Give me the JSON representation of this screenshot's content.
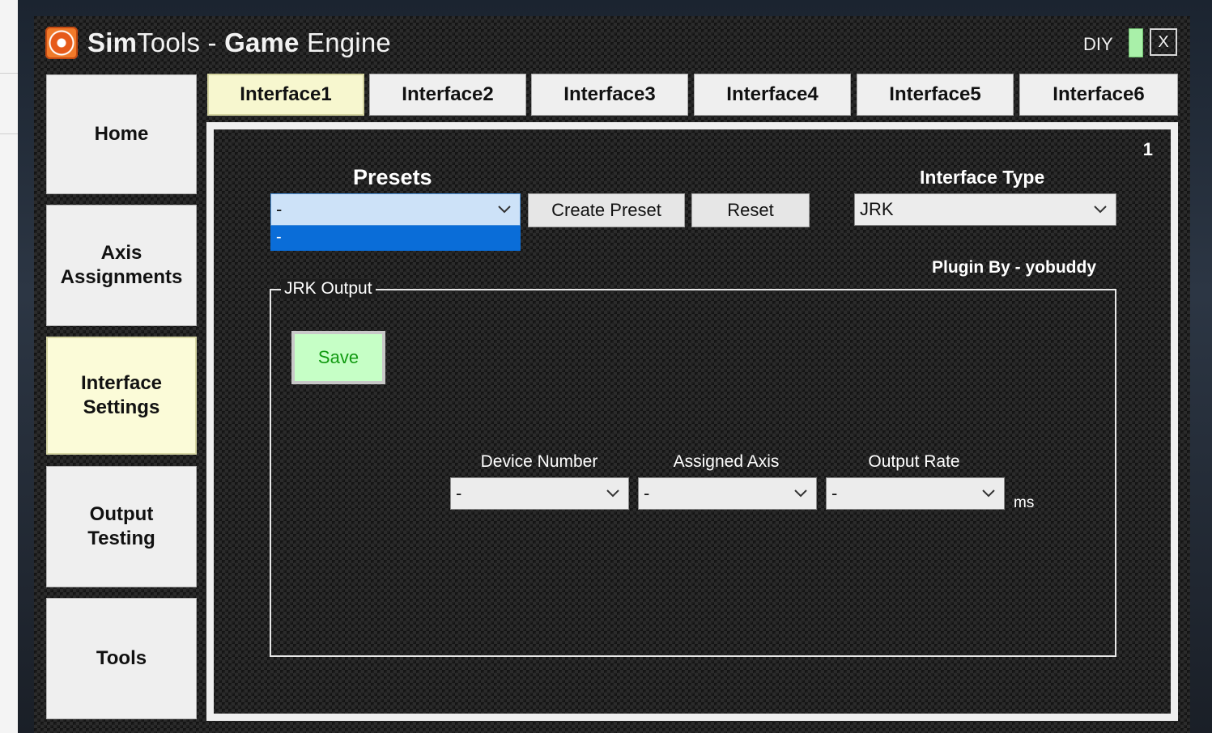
{
  "window": {
    "title_bold_1": "Sim",
    "title_plain_1": "Tools - ",
    "title_bold_2": "Game",
    "title_plain_2": " Engine",
    "diy_label": "DIY",
    "close_label": "X",
    "diy_indicator_color": "#a9f0a9"
  },
  "sidebar": {
    "items": [
      {
        "label_line1": "Home",
        "label_line2": ""
      },
      {
        "label_line1": "Axis",
        "label_line2": "Assignments"
      },
      {
        "label_line1": "Interface",
        "label_line2": "Settings"
      },
      {
        "label_line1": "Output",
        "label_line2": "Testing"
      },
      {
        "label_line1": "Tools",
        "label_line2": ""
      }
    ],
    "active_index": 2
  },
  "tabs": [
    {
      "label": "Interface1"
    },
    {
      "label": "Interface2"
    },
    {
      "label": "Interface3"
    },
    {
      "label": "Interface4"
    },
    {
      "label": "Interface5"
    },
    {
      "label": "Interface6"
    }
  ],
  "panel": {
    "number": "1",
    "presets": {
      "label": "Presets",
      "selected": "-",
      "open_option": "-",
      "create_label": "Create Preset",
      "reset_label": "Reset"
    },
    "interface_type": {
      "label": "Interface Type",
      "selected": "JRK"
    },
    "plugin_by": "Plugin By - yobuddy",
    "jrk_output": {
      "legend": "JRK Output",
      "save_label": "Save",
      "device_number": {
        "label": "Device Number",
        "selected": "-"
      },
      "assigned_axis": {
        "label": "Assigned Axis",
        "selected": "-"
      },
      "output_rate": {
        "label": "Output Rate",
        "selected": "-",
        "unit": "ms"
      }
    }
  }
}
